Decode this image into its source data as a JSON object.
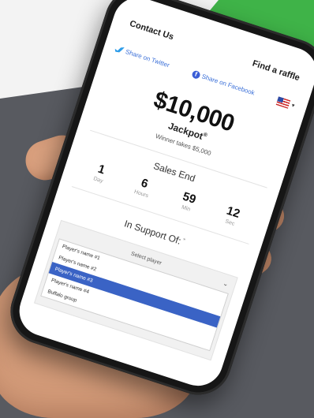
{
  "nav": {
    "contact": "Contact Us",
    "find": "Find a raffle"
  },
  "share": {
    "twitter": "Share on Twitter",
    "facebook": "Share on Facebook",
    "facebook_glyph": "f"
  },
  "jackpot": {
    "amount": "$10,000",
    "label": "Jackpot",
    "mark": "®",
    "winner_text": "Winner takes $5,000"
  },
  "sales_end": {
    "title": "Sales End",
    "countdown": [
      {
        "value": "1",
        "unit": "Day"
      },
      {
        "value": "6",
        "unit": "Hours"
      },
      {
        "value": "59",
        "unit": "Min"
      },
      {
        "value": "12",
        "unit": "Sec"
      }
    ]
  },
  "support": {
    "title": "In Support Of:",
    "required_mark": "*",
    "placeholder": "Select player",
    "options": [
      {
        "label": "Player's name #1",
        "selected": false
      },
      {
        "label": "Player's name #2",
        "selected": false
      },
      {
        "label": "Player's name #3",
        "selected": true
      },
      {
        "label": "Player's name #4",
        "selected": false
      },
      {
        "label": "Buffalo group",
        "selected": false
      }
    ]
  },
  "colors": {
    "accent": "#3a63c5",
    "green": "#3fb348",
    "twitter": "#2d9ce9",
    "facebook": "#3b5ed6",
    "background": "#585a60"
  },
  "icons": [
    "twitter-icon",
    "facebook-icon",
    "us-flag-icon",
    "chevron-down-icon"
  ]
}
